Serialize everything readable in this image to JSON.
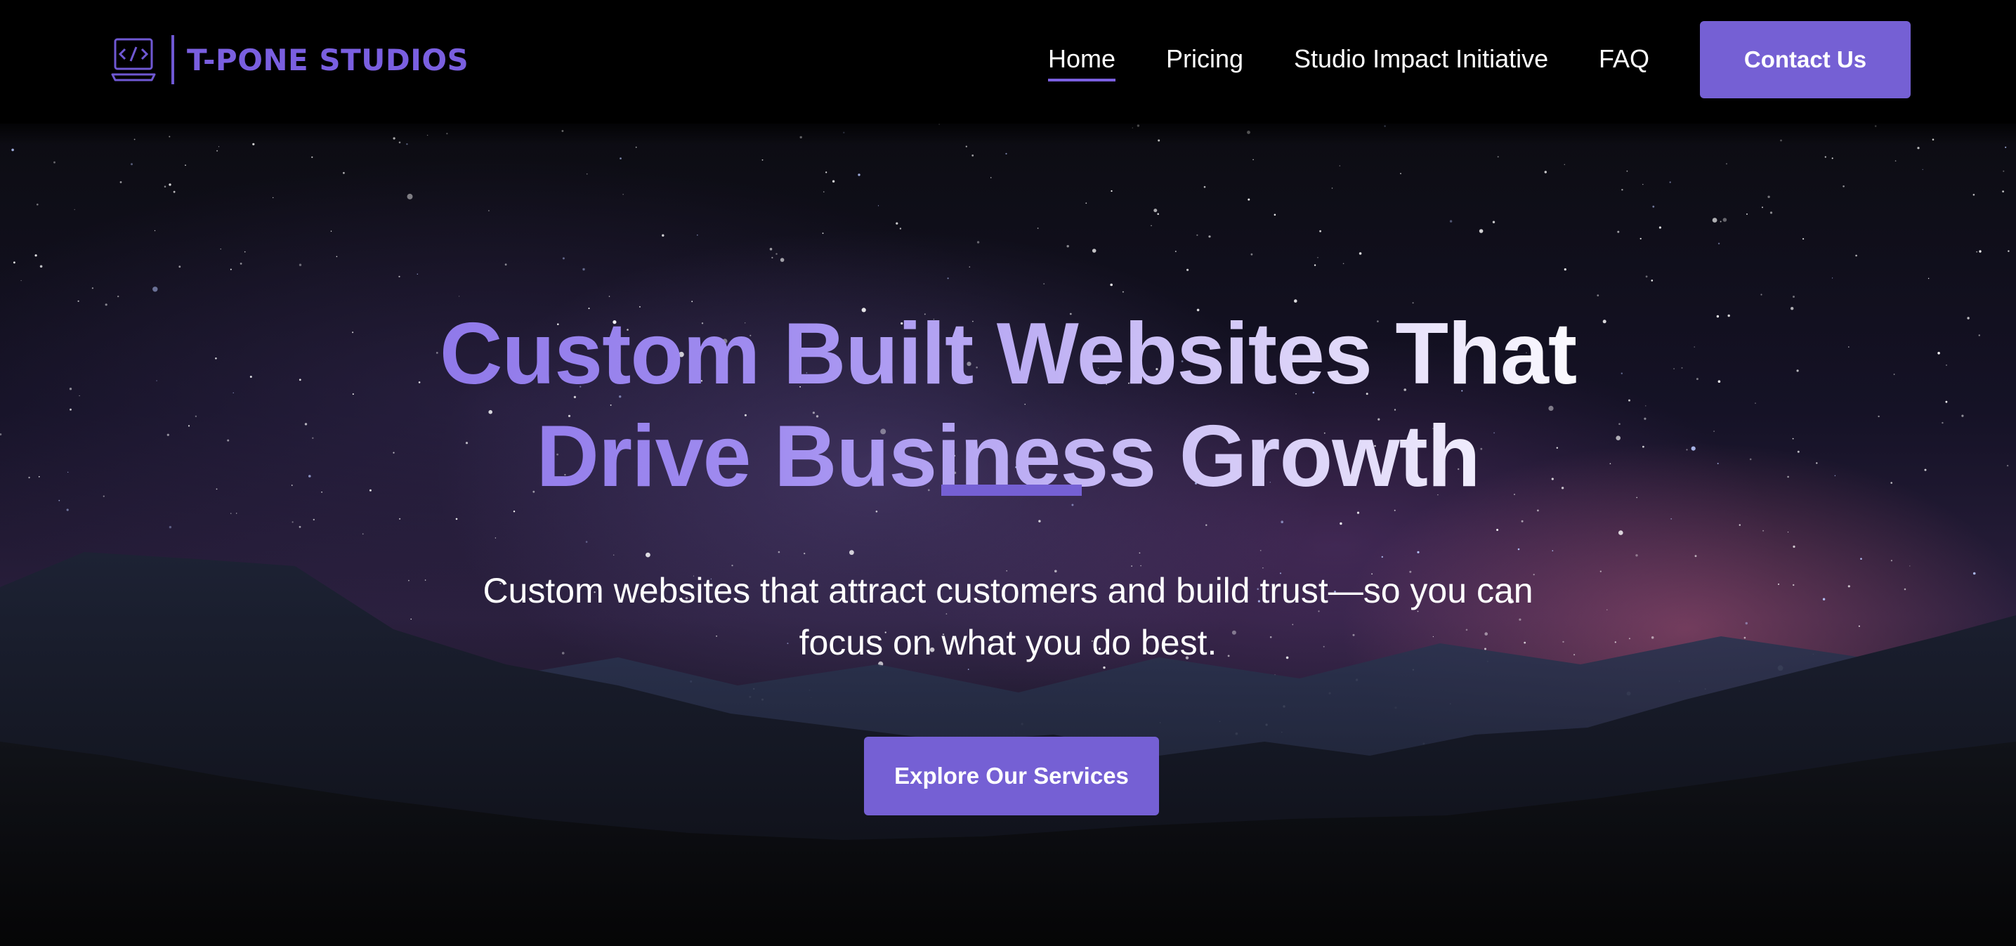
{
  "brand": {
    "name": "T-PONE STUDIOS",
    "logo_icon": "laptop-code-icon",
    "accent_color": "#7560d4"
  },
  "nav": {
    "links": [
      {
        "label": "Home",
        "active": true
      },
      {
        "label": "Pricing",
        "active": false
      },
      {
        "label": "Studio Impact Initiative",
        "active": false
      },
      {
        "label": "FAQ",
        "active": false
      }
    ],
    "cta_label": "Contact Us"
  },
  "hero": {
    "title_line1": "Custom Built Websites That",
    "title_line2": "Drive Business Growth",
    "subtitle_line1": "Custom websites that attract customers and build trust—so you can",
    "subtitle_line2": "focus on what you do best.",
    "cta_label": "Explore Our Services",
    "background": "starry-night-mountains"
  }
}
